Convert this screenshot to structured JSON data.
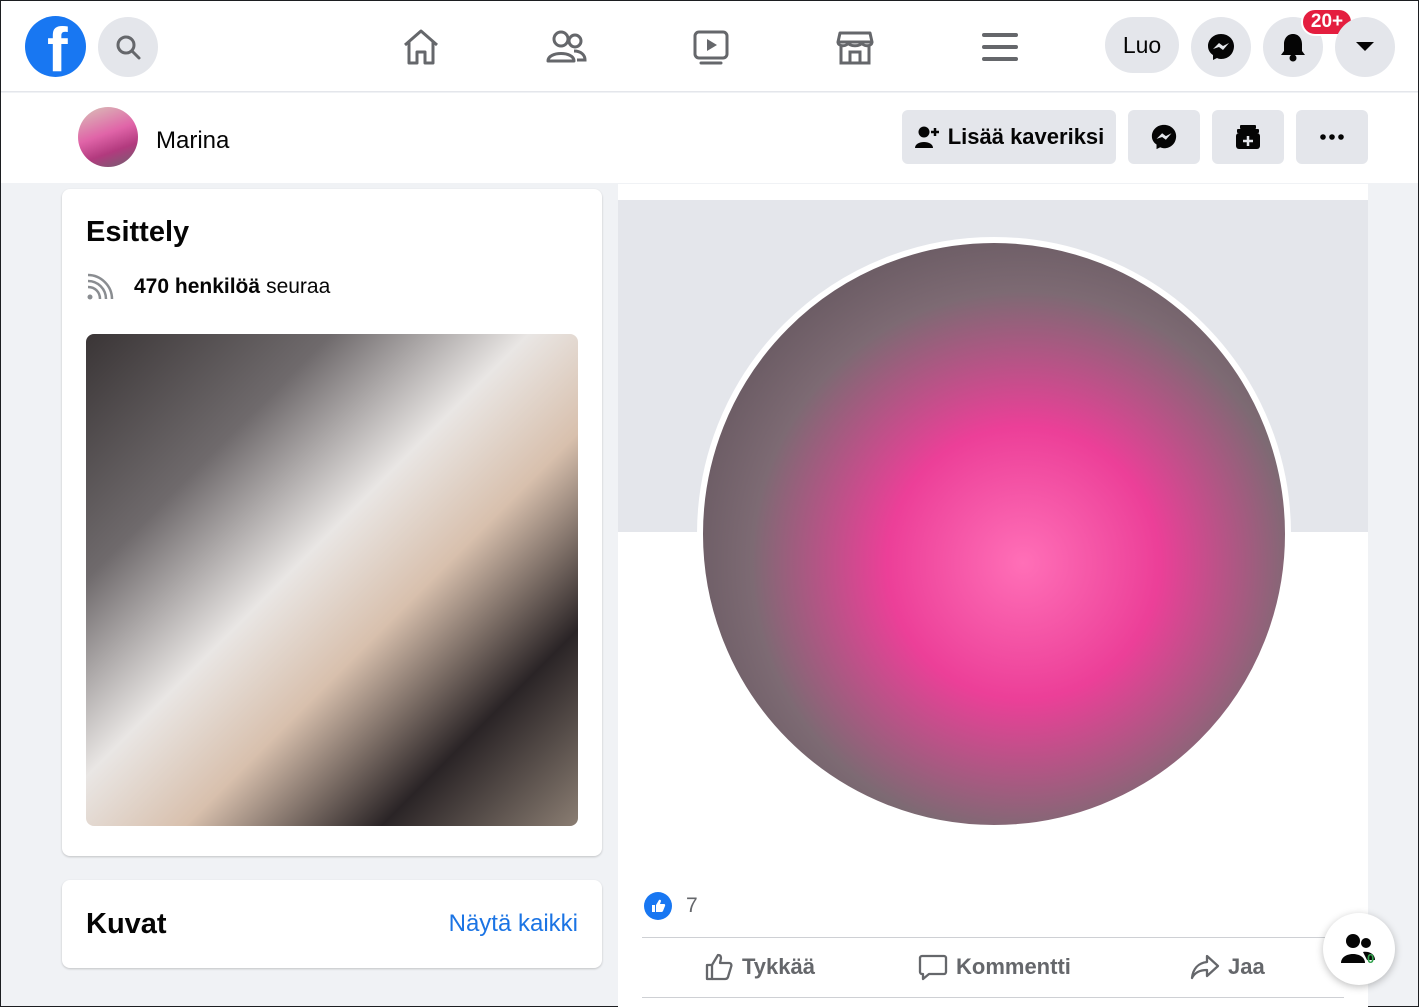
{
  "topbar": {
    "logo_letter": "f",
    "create_label": "Luo",
    "notifications_badge": "20+",
    "icons": [
      "search-icon",
      "home-icon",
      "friends-icon",
      "watch-icon",
      "marketplace-icon",
      "menu-icon",
      "messenger-icon",
      "bell-icon",
      "caret-down-icon"
    ]
  },
  "profile": {
    "name": "Marina",
    "add_friend_label": "Lisää kaveriksi"
  },
  "intro": {
    "title": "Esittely",
    "followers_count": "470 henkilöä",
    "followers_suffix": "seuraa"
  },
  "photos": {
    "title": "Kuvat",
    "see_all": "Näytä kaikki"
  },
  "post": {
    "like_count": "7",
    "actions": {
      "like": "Tykkää",
      "comment": "Kommentti",
      "share": "Jaa"
    }
  },
  "contacts_fab": {
    "count": "0"
  },
  "colors": {
    "brand": "#1877f2",
    "badge": "#e41e3f",
    "link": "#1b74e4",
    "background": "#f0f2f5"
  }
}
